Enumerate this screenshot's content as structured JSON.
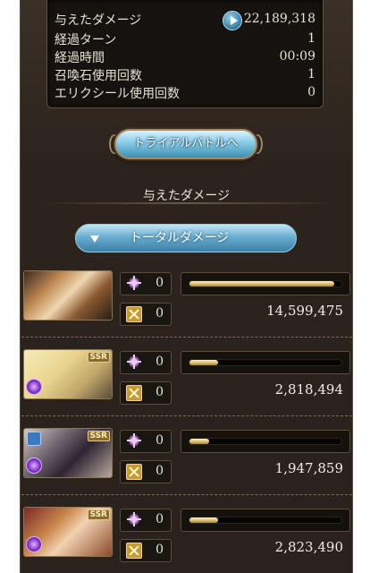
{
  "stats": {
    "rows": [
      {
        "label": "与えたダメージ",
        "value": "22,189,318"
      },
      {
        "label": "経過ターン",
        "value": "1"
      },
      {
        "label": "経過時間",
        "value": "00:09"
      },
      {
        "label": "召喚石使用回数",
        "value": "1"
      },
      {
        "label": "エリクシール使用回数",
        "value": "0"
      }
    ]
  },
  "trial_button": "トライアルバトルへ",
  "section_title": "与えたダメージ",
  "total_button": "トータルダメージ",
  "characters": [
    {
      "sparkle_count": "0",
      "cross_count": "0",
      "damage": "14,599,475",
      "bar_fraction": 0.95,
      "ssr": ""
    },
    {
      "sparkle_count": "0",
      "cross_count": "0",
      "damage": "2,818,494",
      "bar_fraction": 0.19,
      "ssr": "SSR"
    },
    {
      "sparkle_count": "0",
      "cross_count": "0",
      "damage": "1,947,859",
      "bar_fraction": 0.13,
      "ssr": "SSR"
    },
    {
      "sparkle_count": "0",
      "cross_count": "0",
      "damage": "2,823,490",
      "bar_fraction": 0.19,
      "ssr": "SSR"
    }
  ],
  "colors": {
    "bar_fill": "#d9b864",
    "button_blue": "#6aaed0",
    "panel_bg": "#2b231c"
  }
}
